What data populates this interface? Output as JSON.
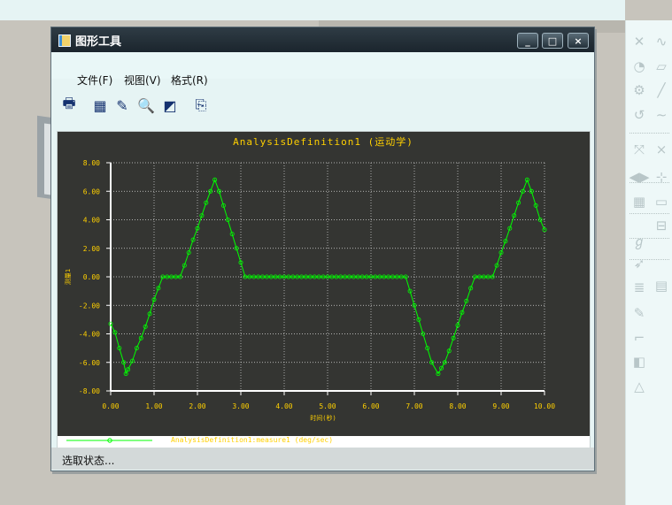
{
  "window": {
    "title": "图形工具",
    "minimize_glyph": "_",
    "maximize_glyph": "□",
    "close_glyph": "×"
  },
  "menu": {
    "file": "文件(F)",
    "view": "视图(V)",
    "format": "格式(R)"
  },
  "toolbar": {
    "icons": [
      "print-icon",
      "grid-icon",
      "edit-icon",
      "zoom-in-icon",
      "refit-icon",
      "export-icon"
    ]
  },
  "status": "选取状态...",
  "chart_data": {
    "type": "line",
    "title": "AnalysisDefinition1 (运动学)",
    "xlabel": "时间(秒)",
    "ylabel": "测量1",
    "xlim": [
      0,
      10
    ],
    "ylim": [
      -8,
      8
    ],
    "x_ticks": [
      "0.00",
      "1.00",
      "2.00",
      "3.00",
      "4.00",
      "5.00",
      "6.00",
      "7.00",
      "8.00",
      "9.00",
      "10.00"
    ],
    "y_ticks": [
      "8.00",
      "6.00",
      "4.00",
      "2.00",
      "0.00",
      "-2.00",
      "-4.00",
      "-6.00",
      "-8.00"
    ],
    "legend": "AnalysisDefinition1:measure1 (deg/sec)",
    "legend_position": "bottom-left",
    "grid": true,
    "line_color": "#00ff00",
    "series": [
      {
        "name": "AnalysisDefinition1:measure1 (deg/sec)",
        "points": [
          [
            0.0,
            -3.3
          ],
          [
            0.1,
            -3.9
          ],
          [
            0.2,
            -5.0
          ],
          [
            0.3,
            -6.0
          ],
          [
            0.35,
            -6.8
          ],
          [
            0.4,
            -6.5
          ],
          [
            0.5,
            -5.9
          ],
          [
            0.6,
            -5.0
          ],
          [
            0.7,
            -4.3
          ],
          [
            0.8,
            -3.5
          ],
          [
            0.9,
            -2.6
          ],
          [
            1.0,
            -1.6
          ],
          [
            1.1,
            -0.8
          ],
          [
            1.2,
            0.0
          ],
          [
            1.6,
            0.0
          ],
          [
            1.7,
            0.8
          ],
          [
            1.8,
            1.7
          ],
          [
            1.9,
            2.6
          ],
          [
            2.0,
            3.4
          ],
          [
            2.1,
            4.3
          ],
          [
            2.2,
            5.2
          ],
          [
            2.3,
            6.0
          ],
          [
            2.4,
            6.8
          ],
          [
            2.5,
            6.0
          ],
          [
            2.6,
            5.0
          ],
          [
            2.7,
            4.0
          ],
          [
            2.8,
            3.0
          ],
          [
            2.9,
            2.0
          ],
          [
            3.0,
            1.0
          ],
          [
            3.1,
            0.0
          ],
          [
            6.8,
            0.0
          ],
          [
            6.9,
            -1.0
          ],
          [
            7.0,
            -2.0
          ],
          [
            7.1,
            -3.0
          ],
          [
            7.2,
            -4.0
          ],
          [
            7.3,
            -5.0
          ],
          [
            7.4,
            -6.0
          ],
          [
            7.55,
            -6.8
          ],
          [
            7.7,
            -6.0
          ],
          [
            7.8,
            -5.2
          ],
          [
            7.9,
            -4.3
          ],
          [
            8.0,
            -3.4
          ],
          [
            8.1,
            -2.5
          ],
          [
            8.2,
            -1.7
          ],
          [
            8.3,
            -0.8
          ],
          [
            8.4,
            0.0
          ],
          [
            8.8,
            0.0
          ],
          [
            8.9,
            0.8
          ],
          [
            9.0,
            1.7
          ],
          [
            9.1,
            2.5
          ],
          [
            9.2,
            3.4
          ],
          [
            9.3,
            4.3
          ],
          [
            9.4,
            5.2
          ],
          [
            9.5,
            6.0
          ],
          [
            9.6,
            6.8
          ],
          [
            9.7,
            6.0
          ],
          [
            9.8,
            5.0
          ],
          [
            9.9,
            4.0
          ],
          [
            10.0,
            3.3
          ]
        ]
      }
    ]
  }
}
